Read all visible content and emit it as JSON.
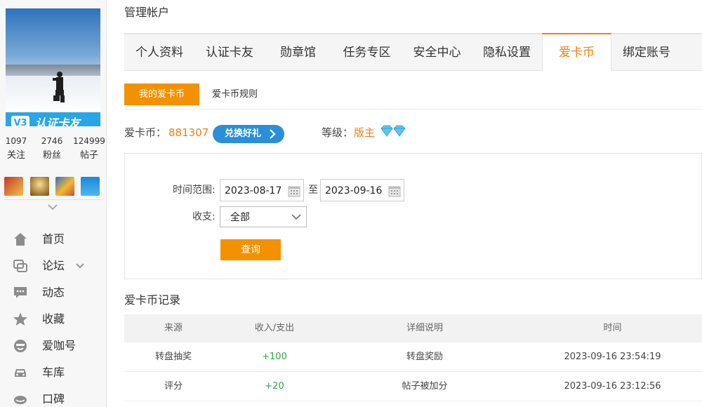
{
  "profile": {
    "badge_level": "V3",
    "badge_text": "认证卡友",
    "stats": [
      {
        "num": "1097",
        "label": "关注"
      },
      {
        "num": "2746",
        "label": "粉丝"
      },
      {
        "num": "124999",
        "label": "帖子"
      }
    ]
  },
  "nav": [
    {
      "label": "首页",
      "icon": "home-icon"
    },
    {
      "label": "论坛",
      "icon": "forum-icon"
    },
    {
      "label": "动态",
      "icon": "feed-icon"
    },
    {
      "label": "收藏",
      "icon": "star-icon"
    },
    {
      "label": "爱咖号",
      "icon": "aika-icon"
    },
    {
      "label": "车库",
      "icon": "car-icon"
    },
    {
      "label": "口碑",
      "icon": "reputation-icon"
    }
  ],
  "page_title": "管理帐户",
  "tabs": [
    {
      "label": "个人资料"
    },
    {
      "label": "认证卡友"
    },
    {
      "label": "勋章馆"
    },
    {
      "label": "任务专区"
    },
    {
      "label": "安全中心"
    },
    {
      "label": "隐私设置"
    },
    {
      "label": "爱卡币",
      "active": true
    },
    {
      "label": "绑定账号"
    }
  ],
  "subtabs": {
    "active": "我的爱卡币",
    "other": "爱卡币规则"
  },
  "coins": {
    "label": "爱卡币：",
    "value": "881307",
    "exchange_label": "兑换好礼",
    "level_label": "等级：",
    "level_value": "版主"
  },
  "filter": {
    "range_label": "时间范围:",
    "start_date": "2023-08-17",
    "to_label": "至",
    "end_date": "2023-09-16",
    "type_label": "收支:",
    "type_value": "全部",
    "query_label": "查询"
  },
  "records": {
    "title": "爱卡币记录",
    "columns": [
      "来源",
      "收入/支出",
      "详细说明",
      "时间"
    ],
    "rows": [
      {
        "source": "转盘抽奖",
        "amount": "+100",
        "detail": "转盘奖励",
        "time": "2023-09-16 23:54:19"
      },
      {
        "source": "评分",
        "amount": "+20",
        "detail": "帖子被加分",
        "time": "2023-09-16 23:12:56"
      }
    ]
  },
  "colors": {
    "accent": "#f39100",
    "link_orange": "#e5821b",
    "blue_button": "#2a8fd8",
    "income_green": "#2ea84a"
  }
}
